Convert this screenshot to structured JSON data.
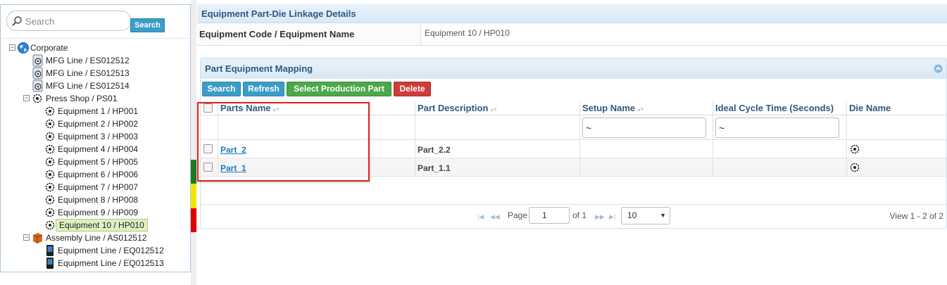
{
  "tree": {
    "search_placeholder": "Search",
    "search_button": "Search",
    "nodes": [
      {
        "label": "Corporate",
        "icon": "globe-icon"
      },
      {
        "label": "MFG Line / ES012512",
        "icon": "line-icon"
      },
      {
        "label": "MFG Line / ES012513",
        "icon": "line-icon"
      },
      {
        "label": "MFG Line / ES012514",
        "icon": "line-icon"
      },
      {
        "label": "Press Shop / PS01",
        "icon": "gear-icon"
      },
      {
        "label": "Equipment 1 / HP001",
        "icon": "gear-icon"
      },
      {
        "label": "Equipment 2 / HP002",
        "icon": "gear-icon"
      },
      {
        "label": "Equipment 3 / HP003",
        "icon": "gear-icon"
      },
      {
        "label": "Equipment 4 / HP004",
        "icon": "gear-icon"
      },
      {
        "label": "Equipment 5 / HP005",
        "icon": "gear-icon"
      },
      {
        "label": "Equipment 6 / HP006",
        "icon": "gear-icon"
      },
      {
        "label": "Equipment 7 / HP007",
        "icon": "gear-icon"
      },
      {
        "label": "Equipment 8 / HP008",
        "icon": "gear-icon"
      },
      {
        "label": "Equipment 9 / HP009",
        "icon": "gear-icon"
      },
      {
        "label": "Equipment 10 / HP010",
        "icon": "gear-icon",
        "selected": true
      },
      {
        "label": "Assembly Line / AS012512",
        "icon": "box-icon"
      },
      {
        "label": "Equipment Line / EQ012512",
        "icon": "device-icon"
      },
      {
        "label": "Equipment Line / EQ012513",
        "icon": "device-icon"
      }
    ]
  },
  "status_colors": {
    "green": "#1f7a1f",
    "yellow": "#f2e600",
    "red": "#e00000"
  },
  "details": {
    "title": "Equipment Part-Die Linkage Details",
    "field_label": "Equipment Code / Equipment Name",
    "field_value": "Equipment 10 / HP010"
  },
  "mapping": {
    "title": "Part Equipment Mapping",
    "buttons": {
      "search": "Search",
      "refresh": "Refresh",
      "select": "Select Production Part",
      "delete": "Delete"
    },
    "columns": [
      "Parts Name",
      "Part Description",
      "Setup Name",
      "Ideal Cycle Time (Seconds)",
      "Die Name"
    ],
    "filters": {
      "setup": "~",
      "cycle": "~"
    },
    "rows": [
      {
        "part": "Part_2",
        "desc": "Part_2.2"
      },
      {
        "part": "Part_1",
        "desc": "Part_1.1"
      }
    ],
    "pager": {
      "page_label": "Page",
      "page": "1",
      "of": "of 1",
      "rows_per_page": "10",
      "view": "View 1 - 2 of 2"
    }
  }
}
